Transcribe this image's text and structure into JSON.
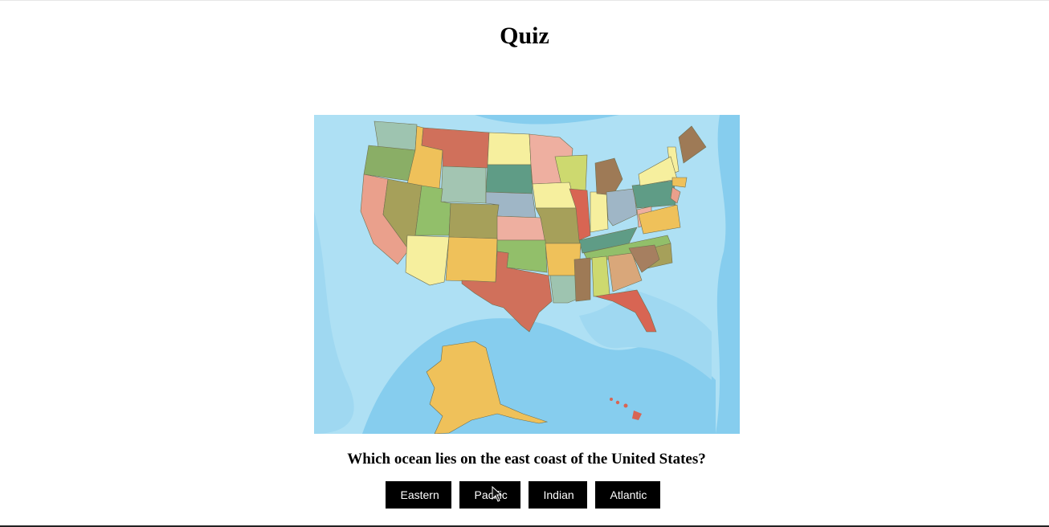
{
  "page": {
    "title": "Quiz"
  },
  "quiz": {
    "image_alt": "Map of the United States",
    "question": "Which ocean lies on the east coast of the United States?",
    "answers": [
      {
        "label": "Eastern"
      },
      {
        "label": "Pacific"
      },
      {
        "label": "Indian"
      },
      {
        "label": "Atlantic"
      }
    ]
  },
  "colors": {
    "ocean_light": "#aee0f4",
    "ocean_mid": "#86cdee",
    "button_bg": "#000000",
    "button_text": "#ffffff"
  },
  "icons": {
    "cursor": "arrow-cursor-icon"
  }
}
